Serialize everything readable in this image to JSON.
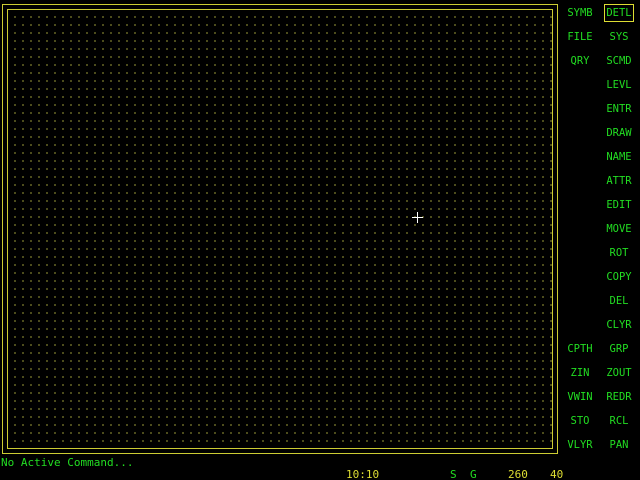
{
  "menu_left": [
    "SYMB",
    "FILE",
    "QRY",
    "",
    "",
    "",
    "",
    "",
    "",
    "",
    "",
    "",
    "",
    "",
    "CPTH",
    "ZIN",
    "VWIN",
    "STO",
    "VLYR"
  ],
  "menu_right": [
    "DETL",
    "SYS",
    "SCMD",
    "LEVL",
    "ENTR",
    "DRAW",
    "NAME",
    "ATTR",
    "EDIT",
    "MOVE",
    "ROT",
    "COPY",
    "DEL",
    "CLYR",
    "GRP",
    "ZOUT",
    "REDR",
    "RCL",
    "PAN"
  ],
  "active_menu": "DETL",
  "status": {
    "command": "No Active Command...",
    "time": "10:10",
    "snap": "S",
    "grid": "G",
    "coord_x": "260",
    "coord_y": "40"
  },
  "colors": {
    "menu_text": "#22dd22",
    "frame": "#cccc33",
    "status_yellow": "#dddd33",
    "background": "#000000"
  }
}
